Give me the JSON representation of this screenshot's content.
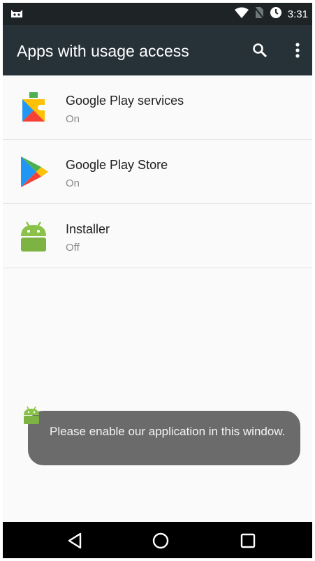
{
  "status_bar": {
    "time": "3:31",
    "icons": [
      "notification-cat-icon",
      "wifi-icon",
      "no-sim-icon",
      "data-saver-icon"
    ]
  },
  "app_bar": {
    "title": "Apps with usage access",
    "actions": [
      "search-icon",
      "more-vert-icon"
    ]
  },
  "apps": [
    {
      "name": "Google Play services",
      "status": "On",
      "icon": "play-services-icon"
    },
    {
      "name": "Google Play Store",
      "status": "On",
      "icon": "play-store-icon"
    },
    {
      "name": "Installer",
      "status": "Off",
      "icon": "android-icon"
    }
  ],
  "toast": {
    "message": "Please enable our application in this window.",
    "icon": "android-icon",
    "background": "#6b6b6b"
  },
  "nav_bar": {
    "buttons": [
      "back-icon",
      "home-icon",
      "recents-icon"
    ]
  },
  "colors": {
    "app_bar": "#263238",
    "status_bar": "#1e2426",
    "list_background": "#fafafa",
    "android_green": "#8bc34a"
  }
}
